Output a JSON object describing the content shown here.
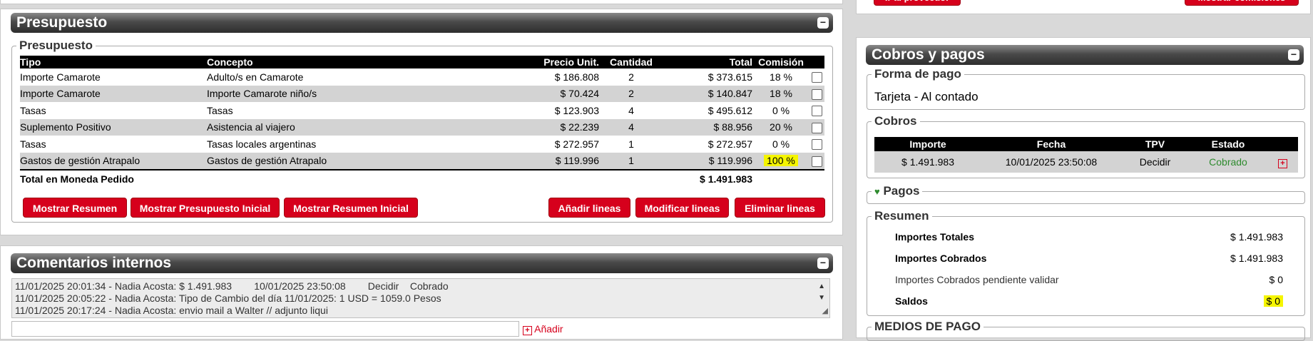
{
  "top_right": {
    "btn_provider": "Ir al proveedor",
    "btn_commissions": "Mostrar comisiones"
  },
  "presupuesto": {
    "section_title": "Presupuesto",
    "legend": "Presupuesto",
    "headers": [
      "Tipo",
      "Concepto",
      "Precio Unit.",
      "Cantidad",
      "Total",
      "Comisión"
    ],
    "rows": [
      {
        "tipo": "Importe Camarote",
        "concepto": "Adulto/s en Camarote",
        "precio": "$ 186.808",
        "cantidad": "2",
        "total": "$ 373.615",
        "comision": "18 %"
      },
      {
        "tipo": "Importe Camarote",
        "concepto": "Importe Camarote niño/s",
        "precio": "$ 70.424",
        "cantidad": "2",
        "total": "$ 140.847",
        "comision": "18 %"
      },
      {
        "tipo": "Tasas",
        "concepto": "Tasas",
        "precio": "$ 123.903",
        "cantidad": "4",
        "total": "$ 495.612",
        "comision": "0 %"
      },
      {
        "tipo": "Suplemento Positivo",
        "concepto": "Asistencia al viajero",
        "precio": "$ 22.239",
        "cantidad": "4",
        "total": "$ 88.956",
        "comision": "20 %"
      },
      {
        "tipo": "Tasas",
        "concepto": "Tasas locales argentinas",
        "precio": "$ 272.957",
        "cantidad": "1",
        "total": "$ 272.957",
        "comision": "0 %"
      },
      {
        "tipo": "Gastos de gestión Atrapalo",
        "concepto": "Gastos de gestión Atrapalo",
        "precio": "$ 119.996",
        "cantidad": "1",
        "total": "$ 119.996",
        "comision": "100 %"
      }
    ],
    "total_label": "Total en Moneda Pedido",
    "total_value": "$ 1.491.983",
    "buttons": {
      "mostrar_resumen": "Mostrar Resumen",
      "mostrar_presupuesto_inicial": "Mostrar Presupuesto Inicial",
      "mostrar_resumen_inicial": "Mostrar Resumen Inicial",
      "anadir_lineas": "Añadir lineas",
      "modificar_lineas": "Modificar lineas",
      "eliminar_lineas": "Eliminar lineas"
    }
  },
  "comentarios": {
    "title": "Comentarios internos",
    "lines": [
      "11/01/2025 20:01:34 - Nadia Acosta: $ 1.491.983        10/01/2025 23:50:08        Decidir    Cobrado",
      "11/01/2025 20:05:22 - Nadia Acosta: Tipo de Cambio del día 11/01/2025: 1 USD = 1059.0 Pesos",
      "11/01/2025 20:17:24 - Nadia Acosta: envio mail a Walter // adjunto liqui"
    ],
    "add_label": "Añadir"
  },
  "cobros_pagos": {
    "title": "Cobros y pagos",
    "forma_pago_legend": "Forma de pago",
    "forma_pago_value": "Tarjeta - Al contado",
    "cobros_legend": "Cobros",
    "cobros_headers": [
      "Importe",
      "Fecha",
      "TPV",
      "Estado"
    ],
    "cobros_rows": [
      {
        "importe": "$ 1.491.983",
        "fecha": "10/01/2025 23:50:08",
        "tpv": "Decidir",
        "estado": "Cobrado"
      }
    ],
    "pagos_legend": "Pagos",
    "resumen_legend": "Resumen",
    "resumen": [
      {
        "label": "Importes Totales",
        "value": "$ 1.491.983"
      },
      {
        "label": "Importes Cobrados",
        "value": "$ 1.491.983"
      },
      {
        "label": "Importes Cobrados pendiente validar",
        "value": "$ 0"
      },
      {
        "label": "Saldos",
        "value": "$ 0"
      }
    ],
    "medios_legend": "MEDIOS DE PAGO"
  },
  "colors": {
    "accent_red": "#d6001c",
    "status_green": "#2e8b2e",
    "highlight": "#f5f500"
  }
}
